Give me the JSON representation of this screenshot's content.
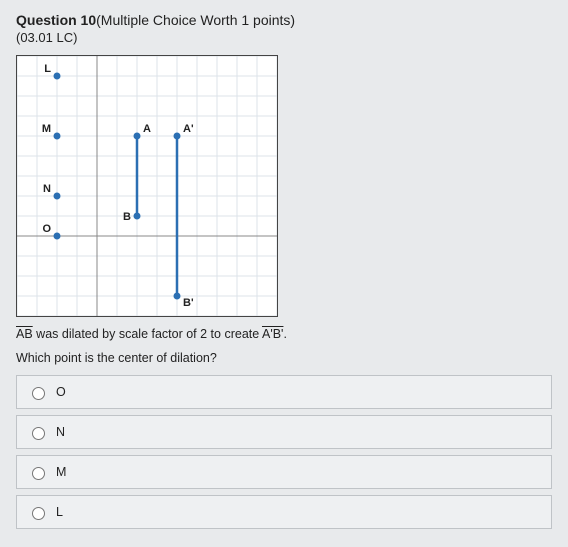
{
  "header": {
    "label": "Question 10",
    "meta": "(Multiple Choice Worth 1 points)",
    "sub": "(03.01 LC)"
  },
  "statement": {
    "pre": "AB",
    "mid": " was dilated by scale factor of 2 to create ",
    "post": "A'B'",
    "tail": "."
  },
  "prompt": "Which point is the center of dilation?",
  "choices": [
    {
      "label": "O"
    },
    {
      "label": "N"
    },
    {
      "label": "M"
    },
    {
      "label": "L"
    }
  ],
  "chart_data": {
    "type": "scatter",
    "title": "",
    "xlabel": "",
    "ylabel": "",
    "xlim": [
      -4,
      9
    ],
    "ylim": [
      -4,
      9
    ],
    "grid": true,
    "points": [
      {
        "name": "L",
        "x": -2,
        "y": 8
      },
      {
        "name": "M",
        "x": -2,
        "y": 5
      },
      {
        "name": "N",
        "x": -2,
        "y": 2
      },
      {
        "name": "O",
        "x": -2,
        "y": 0
      },
      {
        "name": "A",
        "x": 2,
        "y": 5
      },
      {
        "name": "B",
        "x": 2,
        "y": 1
      },
      {
        "name": "A'",
        "x": 4,
        "y": 5
      },
      {
        "name": "B'",
        "x": 4,
        "y": -3
      }
    ],
    "segments": [
      {
        "from": "A",
        "to": "B"
      },
      {
        "from": "A'",
        "to": "B'"
      }
    ]
  }
}
